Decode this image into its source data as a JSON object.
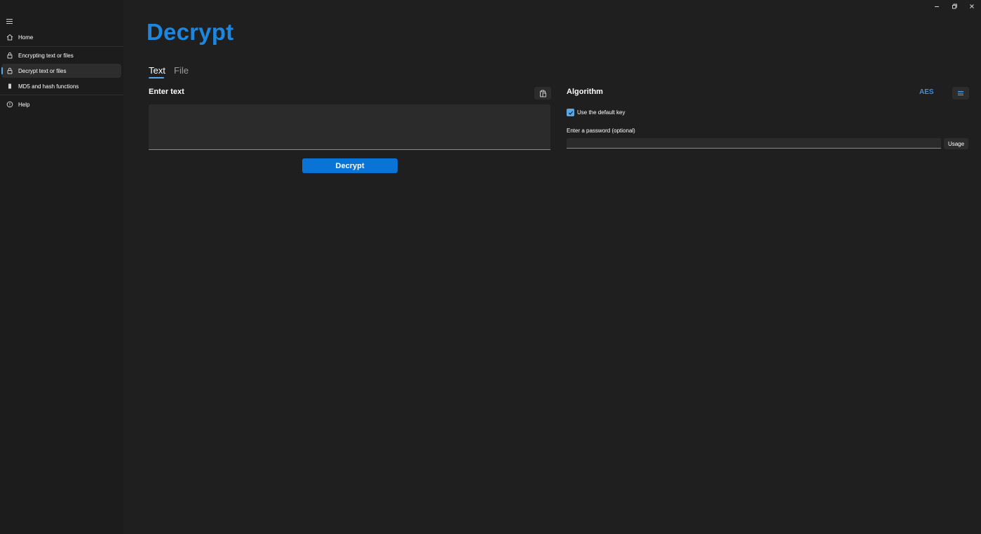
{
  "sidebar": {
    "items": [
      {
        "label": "Home",
        "icon": "home-icon"
      },
      {
        "label": "Encrypting text or files",
        "icon": "lock-icon"
      },
      {
        "label": "Decrypt text or files",
        "icon": "lock-icon",
        "active": true
      },
      {
        "label": "MD5 and hash functions",
        "icon": "file-icon"
      },
      {
        "label": "Help",
        "icon": "help-icon"
      }
    ]
  },
  "window_controls": {
    "minimize": "minimize-icon",
    "restore": "restore-icon",
    "close": "close-icon"
  },
  "page": {
    "title": "Decrypt"
  },
  "tabs": [
    {
      "label": "Text",
      "active": true
    },
    {
      "label": "File",
      "active": false
    }
  ],
  "input_section": {
    "title": "Enter text",
    "paste_icon": "clipboard-paste-icon",
    "text_value": "",
    "decrypt_button": "Decrypt"
  },
  "algorithm_section": {
    "title": "Algorithm",
    "selected": "AES",
    "list_icon": "list-icon",
    "use_default_key": {
      "label": "Use the default key",
      "checked": true
    },
    "password": {
      "label": "Enter a password (optional)",
      "value": ""
    },
    "usage_button": "Usage"
  },
  "colors": {
    "accent": "#1f86dd",
    "button": "#0a74d6",
    "background": "#1f1f1f"
  }
}
